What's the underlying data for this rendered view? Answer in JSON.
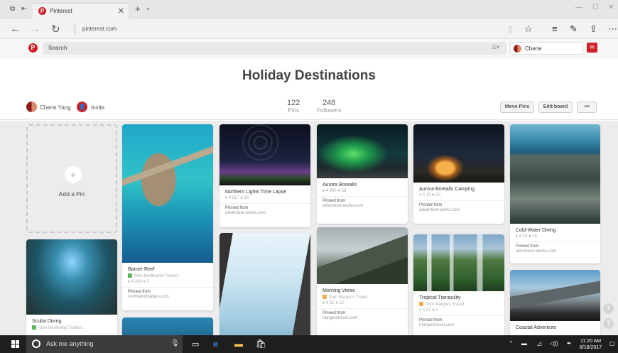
{
  "browser": {
    "tab_title": "Pinterest",
    "url": "pinterest.com"
  },
  "header": {
    "search_placeholder": "Search",
    "user_name": "Cherie"
  },
  "board": {
    "title": "Holiday Destinations",
    "owner": "Cherie Yang",
    "invite": "Invite",
    "pins_count": "122",
    "pins_label": "Pins",
    "followers_count": "248",
    "followers_label": "Followers",
    "move_pins": "Move Pins",
    "edit_board": "Edit board",
    "more": "•••"
  },
  "add_pin": {
    "label": "Add a Pin"
  },
  "pins": [
    {
      "title": "Scuba Diving",
      "source": "from Northwind Traders",
      "source_color": "#5cb85c"
    },
    {
      "title": "Barrier Reef",
      "source": "from Northwind Traders",
      "source_color": "#5cb85c",
      "meta": "♦ 4 209   ♥ 3",
      "pinned_from": "Pinned from",
      "pinned_src": "northwindtraders.com"
    },
    {
      "title": "Northern Lights Time Lapse",
      "meta": "♦ 4 517   ♥ 26",
      "pinned_from": "Pinned from",
      "pinned_src": "adventure-works.com"
    },
    {
      "title": "Aurora Borealis",
      "meta": "♦ 4 380   ♥ 58",
      "pinned_from": "Pinned from",
      "pinned_src": "adventure-works.com"
    },
    {
      "title": "Aurora Borealis Camping",
      "meta": "♦ 4 10   ♥ 10",
      "pinned_from": "Pinned from",
      "pinned_src": "adventure-works.com"
    },
    {
      "title": "Cold-Water Diving",
      "meta": "♦ 4 15   ♥ 16",
      "pinned_from": "Pinned from",
      "pinned_src": "adventure-works.com"
    },
    {
      "title": "Morning Views",
      "source": "from Margie's Travel",
      "source_color": "#f0ad4e",
      "meta": "♦ 4 31   ♥ 12",
      "pinned_from": "Pinned from",
      "pinned_src": "margiestravel.com"
    },
    {
      "title": "Tropical Tranquility",
      "source": "from Margie's Travel",
      "source_color": "#f0ad4e",
      "meta": "♦ 4 21   ♥ 2",
      "pinned_from": "Pinned from",
      "pinned_src": "margiestravel.com"
    },
    {
      "title": "Coastal Adventure"
    }
  ],
  "taskbar": {
    "cortana": "Ask me anything",
    "time": "11:20 AM",
    "date": "8/18/2017"
  },
  "colors": {
    "brand": "#cb2027",
    "grid_bg": "#ececec",
    "taskbar": "#1e1e1e"
  },
  "icons": [
    "back-icon",
    "forward-icon",
    "refresh-icon",
    "star-icon",
    "hub-icon",
    "notes-icon",
    "share-icon",
    "more-icon",
    "plus-icon",
    "help-icon",
    "windows-icon",
    "cortana-icon",
    "mic-icon",
    "task-view-icon",
    "edge-icon",
    "explorer-icon",
    "store-icon"
  ]
}
